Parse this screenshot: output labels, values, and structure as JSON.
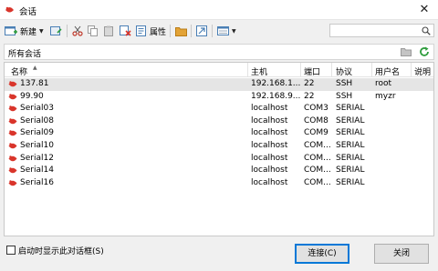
{
  "window": {
    "title": "会话",
    "close_glyph": "✕"
  },
  "toolbar": {
    "new_label": "新建",
    "properties_label": "属性",
    "icons": [
      "new-session-icon",
      "new-folder-icon",
      "cut-icon",
      "copy-icon",
      "paste-icon",
      "delete-icon",
      "properties-icon",
      "open-folder-icon",
      "export-icon",
      "view-icon"
    ]
  },
  "search": {
    "placeholder": ""
  },
  "pathbar": {
    "path": "所有会话"
  },
  "table": {
    "columns": [
      "名称",
      "主机",
      "端口",
      "协议",
      "用户名",
      "说明"
    ],
    "sort_indicator": "▲",
    "rows": [
      {
        "name": "137.81",
        "host": "192.168.1...",
        "port": "22",
        "protocol": "SSH",
        "user": "root",
        "note": "",
        "selected": true
      },
      {
        "name": "99.90",
        "host": "192.168.9...",
        "port": "22",
        "protocol": "SSH",
        "user": "myzr",
        "note": ""
      },
      {
        "name": "Serial03",
        "host": "localhost",
        "port": "COM3",
        "protocol": "SERIAL",
        "user": "",
        "note": ""
      },
      {
        "name": "Serial08",
        "host": "localhost",
        "port": "COM8",
        "protocol": "SERIAL",
        "user": "",
        "note": ""
      },
      {
        "name": "Serial09",
        "host": "localhost",
        "port": "COM9",
        "protocol": "SERIAL",
        "user": "",
        "note": ""
      },
      {
        "name": "Serial10",
        "host": "localhost",
        "port": "COM...",
        "protocol": "SERIAL",
        "user": "",
        "note": ""
      },
      {
        "name": "Serial12",
        "host": "localhost",
        "port": "COM...",
        "protocol": "SERIAL",
        "user": "",
        "note": ""
      },
      {
        "name": "Serial14",
        "host": "localhost",
        "port": "COM...",
        "protocol": "SERIAL",
        "user": "",
        "note": ""
      },
      {
        "name": "Serial16",
        "host": "localhost",
        "port": "COM...",
        "protocol": "SERIAL",
        "user": "",
        "note": ""
      }
    ]
  },
  "footer": {
    "startup_checkbox_label": "启动时显示此对话框(S)",
    "startup_checked": false,
    "connect_label": "连接(C)",
    "close_label": "关闭"
  },
  "colors": {
    "accent": "#0078d7",
    "session_icon": "#d9352b",
    "selected_row": "#e5e5e5"
  }
}
